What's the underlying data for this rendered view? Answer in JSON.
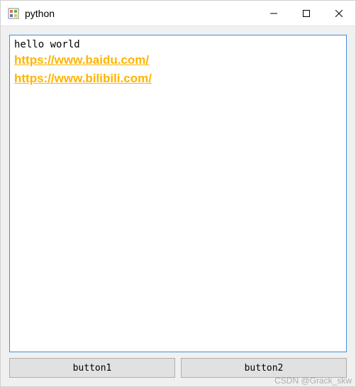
{
  "window": {
    "title": "python"
  },
  "textbrowser": {
    "plain_lines": [
      "hello world"
    ],
    "links": [
      {
        "text": "https://www.baidu.com/"
      },
      {
        "text": "https://www.bilibili.com/"
      }
    ]
  },
  "buttons": {
    "btn1": "button1",
    "btn2": "button2"
  },
  "watermark": "CSDN @Grack_skw"
}
